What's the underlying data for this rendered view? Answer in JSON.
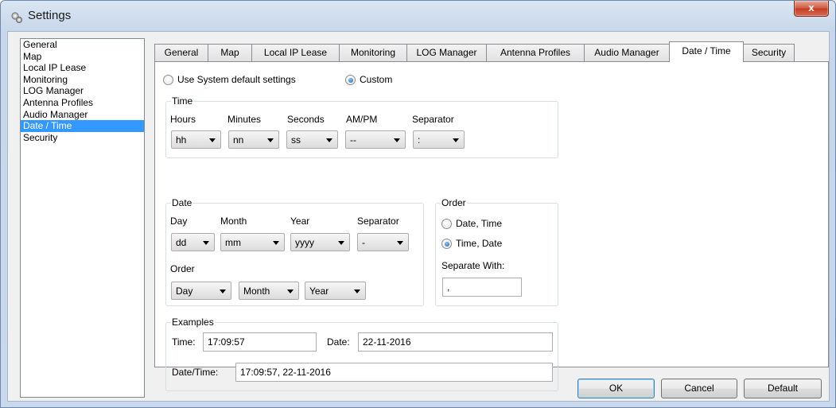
{
  "window": {
    "title": "Settings",
    "close_symbol": "x"
  },
  "sidebar": {
    "items": [
      {
        "label": "General"
      },
      {
        "label": "Map"
      },
      {
        "label": "Local IP Lease"
      },
      {
        "label": "Monitoring"
      },
      {
        "label": "LOG Manager"
      },
      {
        "label": "Antenna Profiles"
      },
      {
        "label": "Audio Manager"
      },
      {
        "label": "Date / Time"
      },
      {
        "label": "Security"
      }
    ],
    "selected_index": 7
  },
  "tabs": [
    {
      "label": "General"
    },
    {
      "label": "Map"
    },
    {
      "label": "Local IP Lease"
    },
    {
      "label": "Monitoring"
    },
    {
      "label": "LOG Manager"
    },
    {
      "label": "Antenna Profiles"
    },
    {
      "label": "Audio Manager"
    },
    {
      "label": "Date / Time"
    },
    {
      "label": "Security"
    }
  ],
  "active_tab": "Date / Time",
  "mode": {
    "system_label": "Use System default settings",
    "custom_label": "Custom",
    "selected": "Custom"
  },
  "time_group": {
    "title": "Time",
    "hours_label": "Hours",
    "hours_value": "hh",
    "minutes_label": "Minutes",
    "minutes_value": "nn",
    "seconds_label": "Seconds",
    "seconds_value": "ss",
    "ampm_label": "AM/PM",
    "ampm_value": "--",
    "separator_label": "Separator",
    "separator_value": ":"
  },
  "date_group": {
    "title": "Date",
    "day_label": "Day",
    "day_value": "dd",
    "month_label": "Month",
    "month_value": "mm",
    "year_label": "Year",
    "year_value": "yyyy",
    "separator_label": "Separator",
    "separator_value": "-",
    "order_label": "Order",
    "order_values": [
      "Day",
      "Month",
      "Year"
    ]
  },
  "order_group": {
    "title": "Order",
    "option_date_time": "Date, Time",
    "option_time_date": "Time, Date",
    "selected": "Time, Date",
    "separate_with_label": "Separate With:",
    "separate_with_value": ","
  },
  "examples_group": {
    "title": "Examples",
    "time_label": "Time:",
    "time_value": "17:09:57",
    "date_label": "Date:",
    "date_value": "22-11-2016",
    "datetime_label": "Date/Time:",
    "datetime_value": "17:09:57, 22-11-2016"
  },
  "buttons": {
    "ok": "OK",
    "cancel": "Cancel",
    "default": "Default"
  },
  "colors": {
    "selection": "#3399ff",
    "radio_dot": "#1c5fb0"
  }
}
